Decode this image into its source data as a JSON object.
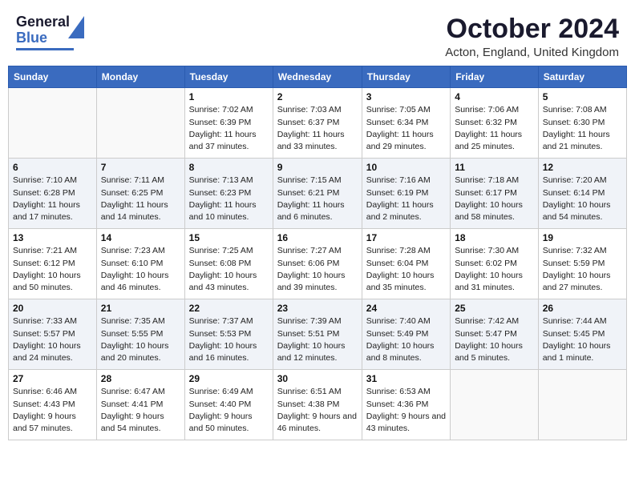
{
  "header": {
    "logo_line1": "General",
    "logo_line2": "Blue",
    "month_title": "October 2024",
    "location": "Acton, England, United Kingdom"
  },
  "days_of_week": [
    "Sunday",
    "Monday",
    "Tuesday",
    "Wednesday",
    "Thursday",
    "Friday",
    "Saturday"
  ],
  "weeks": [
    [
      {
        "day": "",
        "info": ""
      },
      {
        "day": "",
        "info": ""
      },
      {
        "day": "1",
        "info": "Sunrise: 7:02 AM\nSunset: 6:39 PM\nDaylight: 11 hours and 37 minutes."
      },
      {
        "day": "2",
        "info": "Sunrise: 7:03 AM\nSunset: 6:37 PM\nDaylight: 11 hours and 33 minutes."
      },
      {
        "day": "3",
        "info": "Sunrise: 7:05 AM\nSunset: 6:34 PM\nDaylight: 11 hours and 29 minutes."
      },
      {
        "day": "4",
        "info": "Sunrise: 7:06 AM\nSunset: 6:32 PM\nDaylight: 11 hours and 25 minutes."
      },
      {
        "day": "5",
        "info": "Sunrise: 7:08 AM\nSunset: 6:30 PM\nDaylight: 11 hours and 21 minutes."
      }
    ],
    [
      {
        "day": "6",
        "info": "Sunrise: 7:10 AM\nSunset: 6:28 PM\nDaylight: 11 hours and 17 minutes."
      },
      {
        "day": "7",
        "info": "Sunrise: 7:11 AM\nSunset: 6:25 PM\nDaylight: 11 hours and 14 minutes."
      },
      {
        "day": "8",
        "info": "Sunrise: 7:13 AM\nSunset: 6:23 PM\nDaylight: 11 hours and 10 minutes."
      },
      {
        "day": "9",
        "info": "Sunrise: 7:15 AM\nSunset: 6:21 PM\nDaylight: 11 hours and 6 minutes."
      },
      {
        "day": "10",
        "info": "Sunrise: 7:16 AM\nSunset: 6:19 PM\nDaylight: 11 hours and 2 minutes."
      },
      {
        "day": "11",
        "info": "Sunrise: 7:18 AM\nSunset: 6:17 PM\nDaylight: 10 hours and 58 minutes."
      },
      {
        "day": "12",
        "info": "Sunrise: 7:20 AM\nSunset: 6:14 PM\nDaylight: 10 hours and 54 minutes."
      }
    ],
    [
      {
        "day": "13",
        "info": "Sunrise: 7:21 AM\nSunset: 6:12 PM\nDaylight: 10 hours and 50 minutes."
      },
      {
        "day": "14",
        "info": "Sunrise: 7:23 AM\nSunset: 6:10 PM\nDaylight: 10 hours and 46 minutes."
      },
      {
        "day": "15",
        "info": "Sunrise: 7:25 AM\nSunset: 6:08 PM\nDaylight: 10 hours and 43 minutes."
      },
      {
        "day": "16",
        "info": "Sunrise: 7:27 AM\nSunset: 6:06 PM\nDaylight: 10 hours and 39 minutes."
      },
      {
        "day": "17",
        "info": "Sunrise: 7:28 AM\nSunset: 6:04 PM\nDaylight: 10 hours and 35 minutes."
      },
      {
        "day": "18",
        "info": "Sunrise: 7:30 AM\nSunset: 6:02 PM\nDaylight: 10 hours and 31 minutes."
      },
      {
        "day": "19",
        "info": "Sunrise: 7:32 AM\nSunset: 5:59 PM\nDaylight: 10 hours and 27 minutes."
      }
    ],
    [
      {
        "day": "20",
        "info": "Sunrise: 7:33 AM\nSunset: 5:57 PM\nDaylight: 10 hours and 24 minutes."
      },
      {
        "day": "21",
        "info": "Sunrise: 7:35 AM\nSunset: 5:55 PM\nDaylight: 10 hours and 20 minutes."
      },
      {
        "day": "22",
        "info": "Sunrise: 7:37 AM\nSunset: 5:53 PM\nDaylight: 10 hours and 16 minutes."
      },
      {
        "day": "23",
        "info": "Sunrise: 7:39 AM\nSunset: 5:51 PM\nDaylight: 10 hours and 12 minutes."
      },
      {
        "day": "24",
        "info": "Sunrise: 7:40 AM\nSunset: 5:49 PM\nDaylight: 10 hours and 8 minutes."
      },
      {
        "day": "25",
        "info": "Sunrise: 7:42 AM\nSunset: 5:47 PM\nDaylight: 10 hours and 5 minutes."
      },
      {
        "day": "26",
        "info": "Sunrise: 7:44 AM\nSunset: 5:45 PM\nDaylight: 10 hours and 1 minute."
      }
    ],
    [
      {
        "day": "27",
        "info": "Sunrise: 6:46 AM\nSunset: 4:43 PM\nDaylight: 9 hours and 57 minutes."
      },
      {
        "day": "28",
        "info": "Sunrise: 6:47 AM\nSunset: 4:41 PM\nDaylight: 9 hours and 54 minutes."
      },
      {
        "day": "29",
        "info": "Sunrise: 6:49 AM\nSunset: 4:40 PM\nDaylight: 9 hours and 50 minutes."
      },
      {
        "day": "30",
        "info": "Sunrise: 6:51 AM\nSunset: 4:38 PM\nDaylight: 9 hours and 46 minutes."
      },
      {
        "day": "31",
        "info": "Sunrise: 6:53 AM\nSunset: 4:36 PM\nDaylight: 9 hours and 43 minutes."
      },
      {
        "day": "",
        "info": ""
      },
      {
        "day": "",
        "info": ""
      }
    ]
  ]
}
